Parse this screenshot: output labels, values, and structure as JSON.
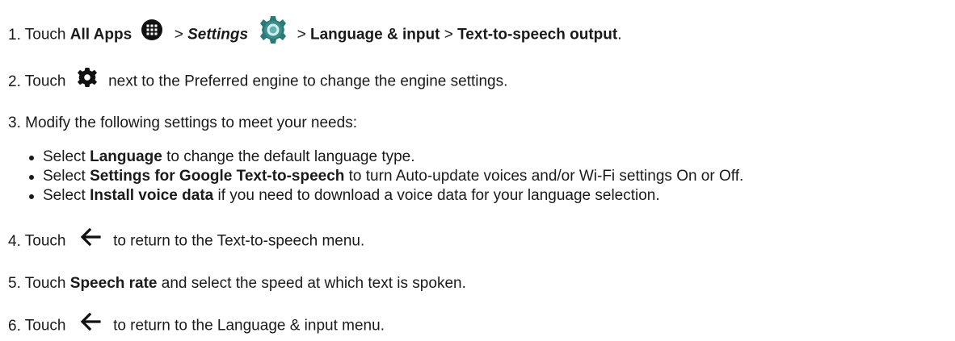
{
  "steps": [
    {
      "num": "1.",
      "touch": "Touch",
      "all_apps": "All Apps",
      "sep1": ">",
      "settings": "Settings",
      "sep2": ">",
      "language_input": "Language & input",
      "sep3": ">",
      "tts_output": "Text-to-speech output",
      "end": ".",
      "icons": [
        "all-apps-icon",
        "settings-app-icon"
      ]
    },
    {
      "num": "2.",
      "touch": "Touch",
      "rest": "next to the Preferred engine to change the engine settings.",
      "icon": "gear-icon"
    },
    {
      "num": "3.",
      "text": "Modify the following settings to meet your needs:",
      "bullets": [
        {
          "pre": "Select",
          "bold": "Language",
          "post": "to change the default language type."
        },
        {
          "pre": "Select",
          "bold": "Settings for Google Text-to-speech",
          "post": "to turn Auto-update voices and/or Wi-Fi settings On or Off."
        },
        {
          "pre": "Select",
          "bold": "Install voice data",
          "post": "if you need to download a voice data for your language selection."
        }
      ]
    },
    {
      "num": "4.",
      "touch": "Touch",
      "rest": "to return to the Text-to-speech menu.",
      "icon": "back-arrow-icon"
    },
    {
      "num": "5.",
      "touch": "Touch",
      "bold": "Speech rate",
      "rest": "and select the speed at which text is spoken."
    },
    {
      "num": "6.",
      "touch": "Touch",
      "rest": "to return to the Language & input menu.",
      "icon": "back-arrow-icon"
    }
  ]
}
